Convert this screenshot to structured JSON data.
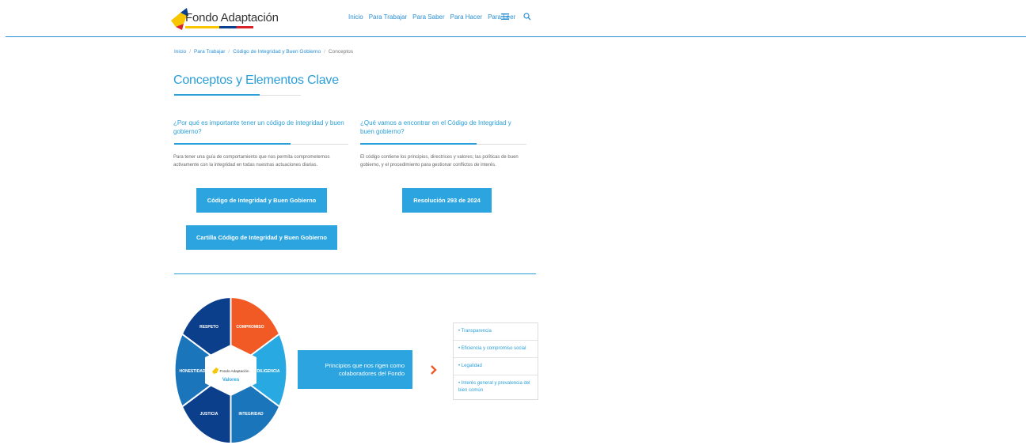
{
  "header": {
    "logo_text": "Fondo Adaptación",
    "nav": [
      "Inicio",
      "Para Trabajar",
      "Para Saber",
      "Para Hacer",
      "Para Leer"
    ],
    "menu_icon": "hamburger-icon",
    "search_icon": "search-icon"
  },
  "breadcrumb": [
    "Inicio",
    "Para Trabajar",
    "Código de Integridad y Buen Gobierno",
    "Conceptos"
  ],
  "page_title": "Conceptos y Elementos Clave",
  "left_column": {
    "heading": "¿Por qué es importante tener un código de integridad y buen gobierno?",
    "body": "Para tener una guía de comportamiento que nos permita comprometernos activamente con la integridad en todas nuestras actuaciones diarias.",
    "buttons": [
      "Código de Integridad y Buen Gobierno",
      "Cartilla Código de Integridad y Buen Gobierno"
    ]
  },
  "right_column": {
    "heading": "¿Qué vamos a encontrar en el Código de Integridad y buen gobierno?",
    "body": "El código contiene los principios, directrices y valores; las políticas de buen gobierno, y el procedimiento para gestionar conflictos de interés.",
    "button": "Resolución 293 de 2024"
  },
  "wheel": {
    "center_logo": "Fondo Adaptación",
    "center_label": "Valores",
    "segments": [
      "COMPROMISO",
      "DILIGENCIA",
      "INTEGRIDAD",
      "JUSTICIA",
      "HONESTIDAD",
      "RESPETO"
    ],
    "colors": [
      "#f15a24",
      "#29a9e1",
      "#1b75bb",
      "#0b3f8c",
      "#1b75bb",
      "#0b3f8c"
    ]
  },
  "principles": {
    "label": "Principios que nos rigen como colaboradores del Fondo",
    "items": [
      "• Transparencia",
      "• Eficiencia y compromiso social",
      "• Legalidad",
      "• Interés general y prevalencia del bien común"
    ]
  },
  "colors": {
    "accent": "#2ba4e0",
    "brand_blue": "#0b3f8c",
    "brand_orange": "#f15a24"
  }
}
